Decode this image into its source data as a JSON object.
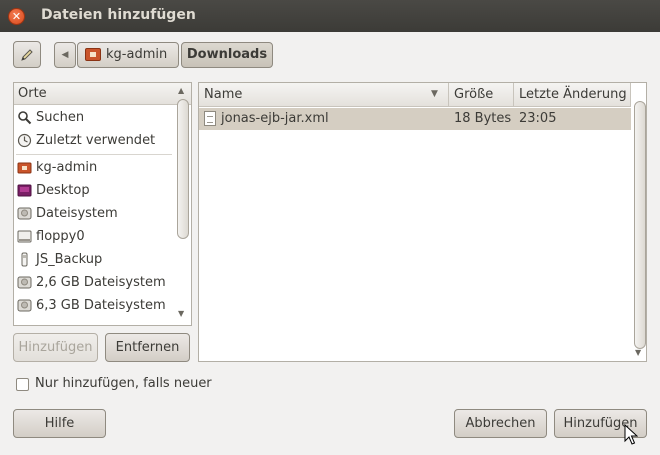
{
  "window": {
    "title": "Dateien hinzufügen"
  },
  "path_bar": {
    "crumbs": [
      "kg-admin",
      "Downloads"
    ]
  },
  "places": {
    "header": "Orte",
    "items": [
      {
        "label": "Suchen",
        "icon": "search-icon"
      },
      {
        "label": "Zuletzt verwendet",
        "icon": "recent-clock-icon"
      },
      {
        "label": "kg-admin",
        "icon": "home-folder-icon"
      },
      {
        "label": "Desktop",
        "icon": "desktop-icon"
      },
      {
        "label": "Dateisystem",
        "icon": "harddisk-icon"
      },
      {
        "label": "floppy0",
        "icon": "floppy-icon"
      },
      {
        "label": "JS_Backup",
        "icon": "usb-drive-icon"
      },
      {
        "label": "2,6 GB Dateisystem",
        "icon": "harddisk-icon"
      },
      {
        "label": "6,3 GB Dateisystem",
        "icon": "harddisk-icon"
      }
    ],
    "add_label": "Hinzufügen",
    "remove_label": "Entfernen"
  },
  "files": {
    "columns": {
      "name": "Name",
      "size": "Größe",
      "modified": "Letzte Änderung"
    },
    "rows": [
      {
        "name": "jonas-ejb-jar.xml",
        "size": "18 Bytes",
        "modified": "23:05"
      }
    ]
  },
  "option": {
    "label": "Nur hinzufügen, falls neuer",
    "checked": false
  },
  "buttons": {
    "help": "Hilfe",
    "cancel": "Abbrechen",
    "add": "Hinzufügen"
  },
  "colors": {
    "titlebar": "#3c3b37",
    "selection": "#d5cec2",
    "close": "#df5721"
  }
}
